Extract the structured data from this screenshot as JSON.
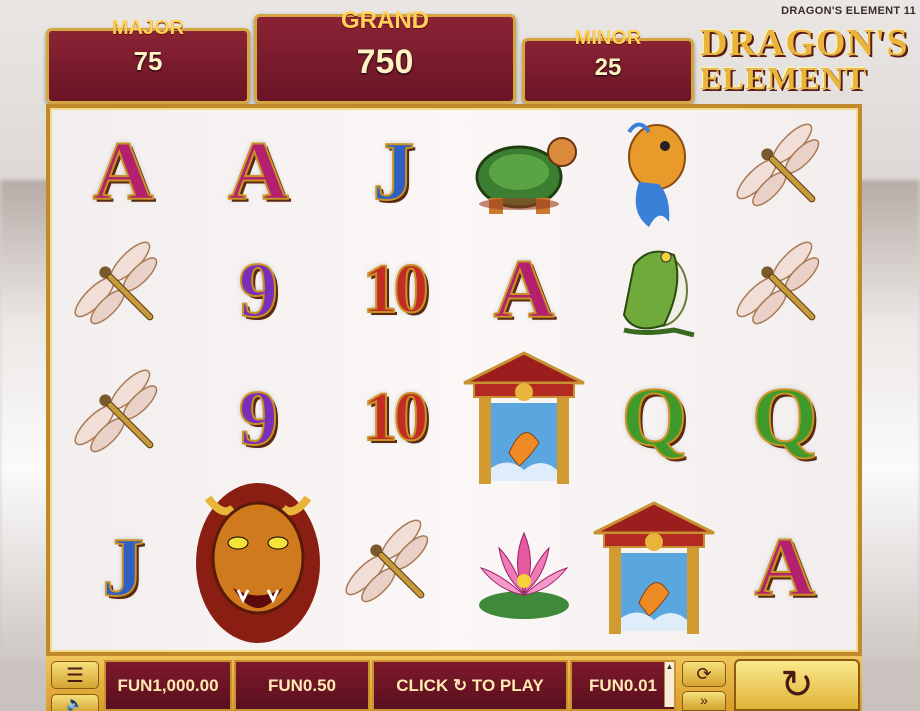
{
  "header": {
    "game_title_tag": "DRAGON'S ELEMENT 11"
  },
  "jackpots": {
    "major": {
      "label": "MAJOR",
      "value": "75"
    },
    "grand": {
      "label": "GRAND",
      "value": "750"
    },
    "minor": {
      "label": "MINOR",
      "value": "25"
    }
  },
  "logo": {
    "line1": "DRAGON'S",
    "line2": "ELEMENT"
  },
  "reels": {
    "rows": [
      [
        "A",
        "A",
        "J",
        "turtle",
        "koi-fish",
        "dragonfly"
      ],
      [
        "dragonfly",
        "9",
        "10",
        "A",
        "frog",
        "dragonfly"
      ],
      [
        "dragonfly",
        "9",
        "10",
        "pagoda-koi",
        "Q",
        "Q"
      ],
      [
        "J",
        "dragon-wild",
        "dragonfly",
        "lotus",
        "pagoda-koi",
        "A"
      ]
    ]
  },
  "bottom_bar": {
    "menu_icon": "menu-icon",
    "sound_icon": "sound-icon",
    "balance": "FUN1,000.00",
    "bet": "FUN0.50",
    "play_prompt": "CLICK ↻ TO PLAY",
    "win": "FUN0.01",
    "autoplay_icon": "autoplay-icon",
    "turbo_icon": "turbo-icon",
    "spin_icon": "spin-icon"
  },
  "colors": {
    "panel_maroon": "#7d1a2c",
    "gold": "#d4a640",
    "frame_gold": "#c08a2a"
  }
}
